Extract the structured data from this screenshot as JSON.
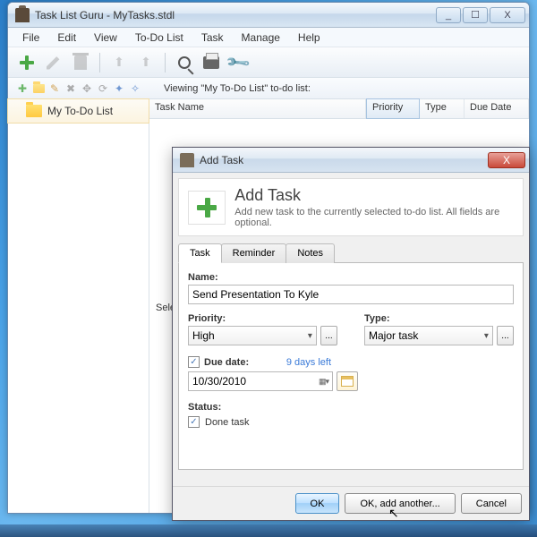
{
  "window": {
    "title": "Task List Guru - MyTasks.stdl",
    "min": "_",
    "max": "☐",
    "close": "X"
  },
  "menu": {
    "file": "File",
    "edit": "Edit",
    "view": "View",
    "todo": "To-Do List",
    "task": "Task",
    "manage": "Manage",
    "help": "Help"
  },
  "toolbar2": {
    "viewing": "Viewing \"My To-Do List\" to-do list:"
  },
  "tree": {
    "item1": "My To-Do List"
  },
  "columns": {
    "name": "Task Name",
    "priority": "Priority",
    "type": "Type",
    "due": "Due Date"
  },
  "selection_hint": "Sele",
  "dialog": {
    "title": "Add Task",
    "heading": "Add Task",
    "sub": "Add new task to the currently selected to-do list. All fields are optional.",
    "tabs": {
      "task": "Task",
      "reminder": "Reminder",
      "notes": "Notes"
    },
    "name_label": "Name:",
    "name_value": "Send Presentation To Kyle",
    "priority_label": "Priority:",
    "priority_value": "High",
    "type_label": "Type:",
    "type_value": "Major task",
    "ellipsis": "...",
    "due_label": "Due date:",
    "days_left": "9 days left",
    "due_value": "10/30/2010",
    "status_label": "Status:",
    "done_label": "Done task",
    "ok": "OK",
    "ok_add": "OK, add another...",
    "cancel": "Cancel",
    "close_x": "X"
  }
}
